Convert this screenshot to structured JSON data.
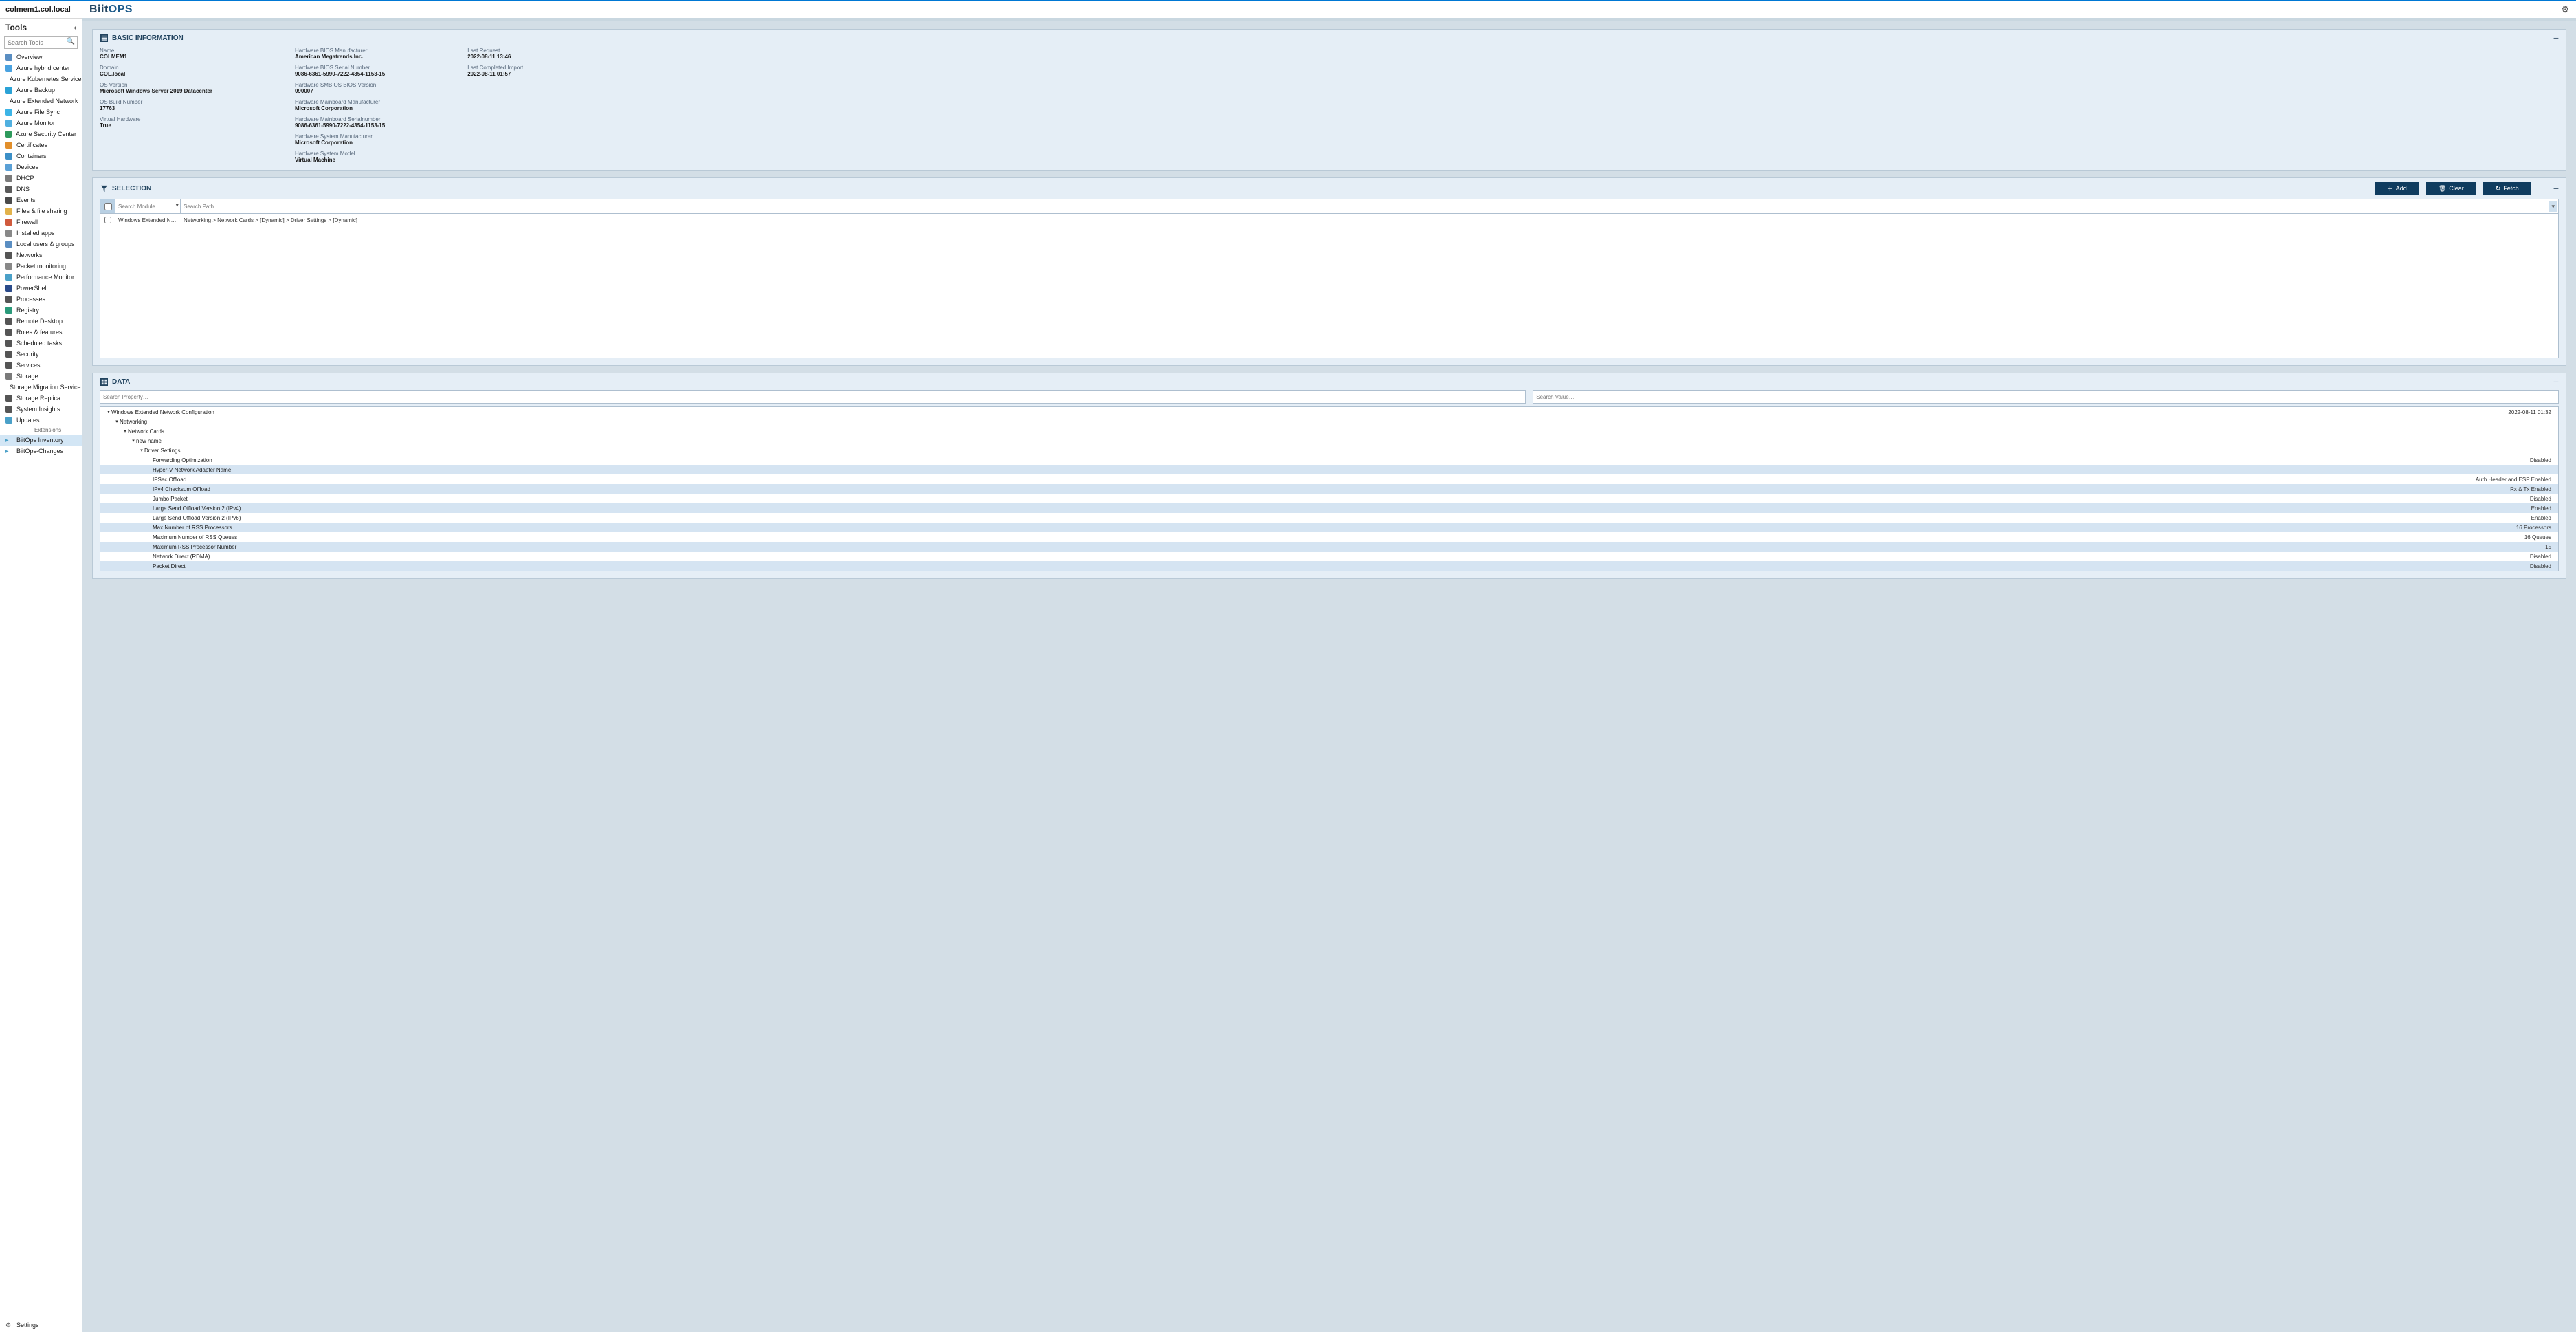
{
  "host": "colmem1.col.local",
  "tools_label": "Tools",
  "search_tools_ph": "Search Tools",
  "sidebar": {
    "items": [
      {
        "label": "Overview",
        "color": "#5a8ec2"
      },
      {
        "label": "Azure hybrid center",
        "color": "#4aa2e0"
      },
      {
        "label": "Azure Kubernetes Service",
        "color": "#326ce5"
      },
      {
        "label": "Azure Backup",
        "color": "#2aa2d6"
      },
      {
        "label": "Azure Extended Network",
        "color": "#888"
      },
      {
        "label": "Azure File Sync",
        "color": "#3cb4e6"
      },
      {
        "label": "Azure Monitor",
        "color": "#50b0e0"
      },
      {
        "label": "Azure Security Center",
        "color": "#2e9a5c"
      },
      {
        "label": "Certificates",
        "color": "#e28f2b"
      },
      {
        "label": "Containers",
        "color": "#3c8fc7"
      },
      {
        "label": "Devices",
        "color": "#5aa0d6"
      },
      {
        "label": "DHCP",
        "color": "#7a7a7a"
      },
      {
        "label": "DNS",
        "color": "#5a5a5a"
      },
      {
        "label": "Events",
        "color": "#4a4a4a"
      },
      {
        "label": "Files & file sharing",
        "color": "#e2b24a"
      },
      {
        "label": "Firewall",
        "color": "#d05a3c"
      },
      {
        "label": "Installed apps",
        "color": "#888"
      },
      {
        "label": "Local users & groups",
        "color": "#5a8ec2"
      },
      {
        "label": "Networks",
        "color": "#555"
      },
      {
        "label": "Packet monitoring",
        "color": "#888"
      },
      {
        "label": "Performance Monitor",
        "color": "#4aa0c8"
      },
      {
        "label": "PowerShell",
        "color": "#2a4a8a"
      },
      {
        "label": "Processes",
        "color": "#555"
      },
      {
        "label": "Registry",
        "color": "#2a9a7a"
      },
      {
        "label": "Remote Desktop",
        "color": "#555"
      },
      {
        "label": "Roles & features",
        "color": "#555"
      },
      {
        "label": "Scheduled tasks",
        "color": "#555"
      },
      {
        "label": "Security",
        "color": "#555"
      },
      {
        "label": "Services",
        "color": "#555"
      },
      {
        "label": "Storage",
        "color": "#7a7a7a"
      },
      {
        "label": "Storage Migration Service",
        "color": "#555"
      },
      {
        "label": "Storage Replica",
        "color": "#555"
      },
      {
        "label": "System Insights",
        "color": "#555"
      },
      {
        "label": "Updates",
        "color": "#4aa0c8"
      }
    ],
    "ext_group": "Extensions",
    "ext_items": [
      {
        "label": "BiitOps Inventory",
        "active": true
      },
      {
        "label": "BiitOps-Changes",
        "active": false
      }
    ],
    "footer": {
      "label": "Settings"
    }
  },
  "brand": {
    "part1": "Biit",
    "part2": "OPS"
  },
  "panels": {
    "basic": {
      "title": "BASIC INFORMATION",
      "col1": [
        {
          "lbl": "Name",
          "val": "COLMEM1"
        },
        {
          "lbl": "Domain",
          "val": "COL.local"
        },
        {
          "lbl": "OS Version",
          "val": "Microsoft Windows Server 2019 Datacenter"
        },
        {
          "lbl": "OS Build Number",
          "val": "17763"
        },
        {
          "lbl": "Virtual Hardware",
          "val": "True"
        }
      ],
      "col2": [
        {
          "lbl": "Hardware BIOS Manufacturer",
          "val": "American Megatrends Inc."
        },
        {
          "lbl": "Hardware BIOS Serial Number",
          "val": "9086-6361-5990-7222-4354-1153-15"
        },
        {
          "lbl": "Hardware SMBIOS BIOS Version",
          "val": "090007"
        },
        {
          "lbl": "Hardware Mainboard Manufacturer",
          "val": "Microsoft Corporation"
        },
        {
          "lbl": "Hardware Mainboard Serialnumber",
          "val": "9086-6361-5990-7222-4354-1153-15"
        },
        {
          "lbl": "Hardware System Manufacturer",
          "val": "Microsoft Corporation"
        },
        {
          "lbl": "Hardware System Model",
          "val": "Virtual Machine"
        }
      ],
      "col3": [
        {
          "lbl": "Last Request",
          "val": "2022-08-11 13:46"
        },
        {
          "lbl": "Last Completed Import",
          "val": "2022-08-11 01:57"
        }
      ]
    },
    "selection": {
      "title": "SELECTION",
      "add": "Add",
      "clear": "Clear",
      "fetch": "Fetch",
      "search_module_ph": "Search Module…",
      "search_path_ph": "Search Path…",
      "rows": [
        {
          "module": "Windows Extended Network Configura…",
          "path": "Networking > Network Cards > [Dynamic] > Driver Settings > [Dynamic]"
        }
      ]
    },
    "data": {
      "title": "DATA",
      "search_prop_ph": "Search Property…",
      "search_val_ph": "Search Value…",
      "root_ts": "2022-08-11 01:32",
      "tree": [
        {
          "depth": 0,
          "branch": true,
          "label": "Windows Extended Network Configuration"
        },
        {
          "depth": 1,
          "branch": true,
          "label": "Networking"
        },
        {
          "depth": 2,
          "branch": true,
          "label": "Network Cards"
        },
        {
          "depth": 3,
          "branch": true,
          "label": "new name"
        },
        {
          "depth": 4,
          "branch": true,
          "label": "Driver Settings"
        },
        {
          "depth": 5,
          "branch": false,
          "label": "Forwarding Optimization",
          "value": "Disabled"
        },
        {
          "depth": 5,
          "branch": false,
          "label": "Hyper-V Network Adapter Name",
          "value": ""
        },
        {
          "depth": 5,
          "branch": false,
          "label": "IPSec Offload",
          "value": "Auth Header and ESP Enabled"
        },
        {
          "depth": 5,
          "branch": false,
          "label": "IPv4 Checksum Offload",
          "value": "Rx & Tx Enabled"
        },
        {
          "depth": 5,
          "branch": false,
          "label": "Jumbo Packet",
          "value": "Disabled"
        },
        {
          "depth": 5,
          "branch": false,
          "label": "Large Send Offload Version 2 (IPv4)",
          "value": "Enabled"
        },
        {
          "depth": 5,
          "branch": false,
          "label": "Large Send Offload Version 2 (IPv6)",
          "value": "Enabled"
        },
        {
          "depth": 5,
          "branch": false,
          "label": "Max Number of RSS Processors",
          "value": "16 Processors"
        },
        {
          "depth": 5,
          "branch": false,
          "label": "Maximum Number of RSS Queues",
          "value": "16 Queues"
        },
        {
          "depth": 5,
          "branch": false,
          "label": "Maximum RSS Processor Number",
          "value": "15"
        },
        {
          "depth": 5,
          "branch": false,
          "label": "Network Direct (RDMA)",
          "value": "Disabled"
        },
        {
          "depth": 5,
          "branch": false,
          "label": "Packet Direct",
          "value": "Disabled"
        }
      ]
    }
  }
}
